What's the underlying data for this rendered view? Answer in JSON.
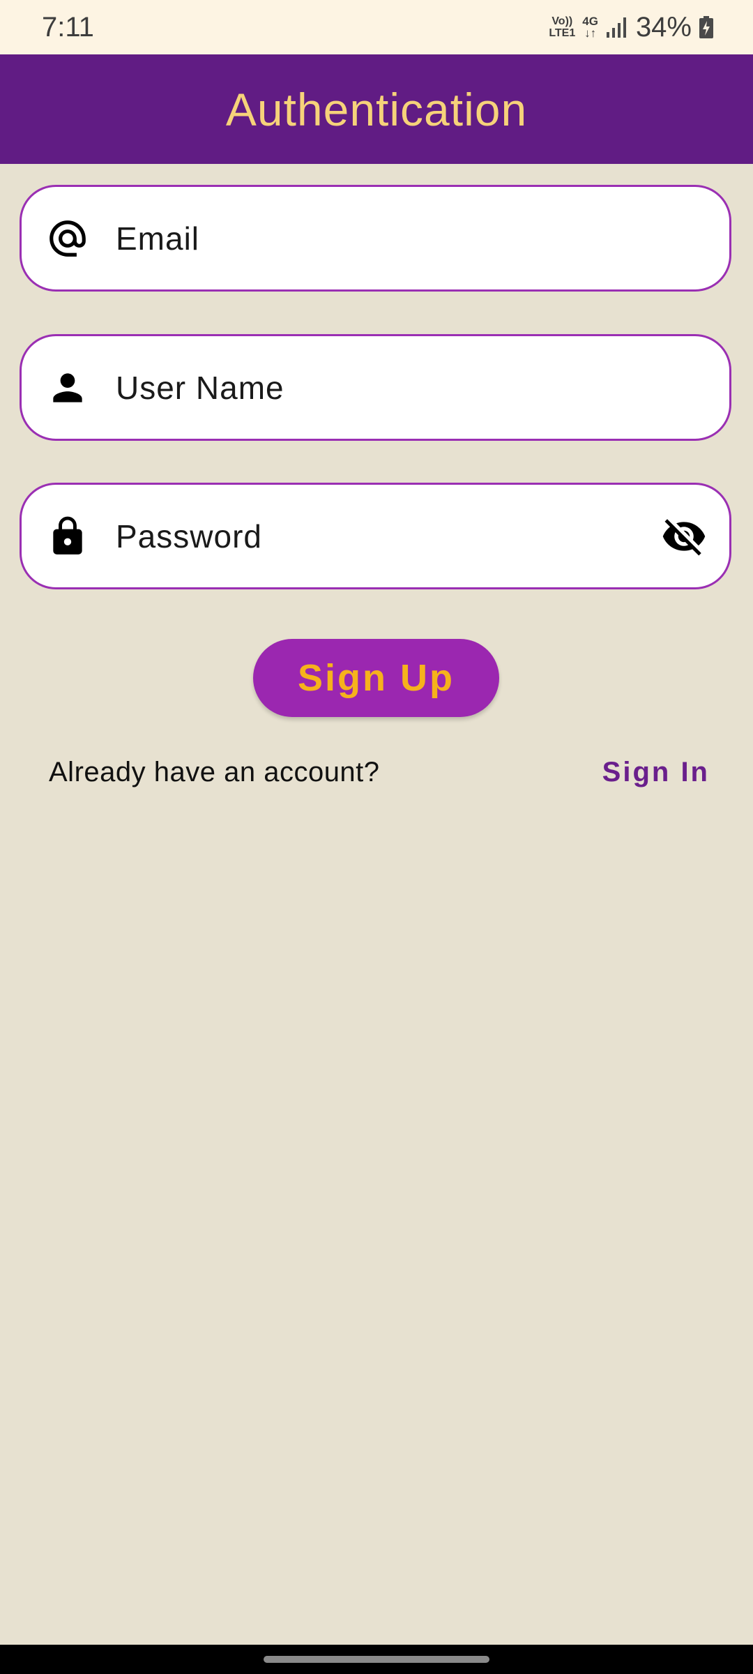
{
  "status_bar": {
    "time": "7:11",
    "volte_top": "Vo))",
    "volte_bottom": "LTE1",
    "network_top": "4G",
    "network_bottom": "↓↑",
    "battery": "34%",
    "icons": [
      "signal-icon",
      "battery-charging-icon"
    ]
  },
  "app_bar": {
    "title": "Authentication"
  },
  "form": {
    "email": {
      "placeholder": "Email",
      "icon": "at-sign-icon"
    },
    "username": {
      "placeholder": "User Name",
      "icon": "person-icon"
    },
    "password": {
      "placeholder": "Password",
      "icon": "lock-icon",
      "toggle_icon": "visibility-off-icon"
    }
  },
  "actions": {
    "signup_label": "Sign Up",
    "already_text": "Already have an account?",
    "signin_label": "Sign In"
  },
  "colors": {
    "status_bar_bg": "#fdf4e3",
    "app_bar_bg": "#611c84",
    "title_color": "#f6d27a",
    "page_bg": "#e7e1d0",
    "field_border": "#9a2fb3",
    "button_bg": "#9b27b0",
    "button_text": "#f6b21c",
    "link_color": "#6a1f8c"
  }
}
